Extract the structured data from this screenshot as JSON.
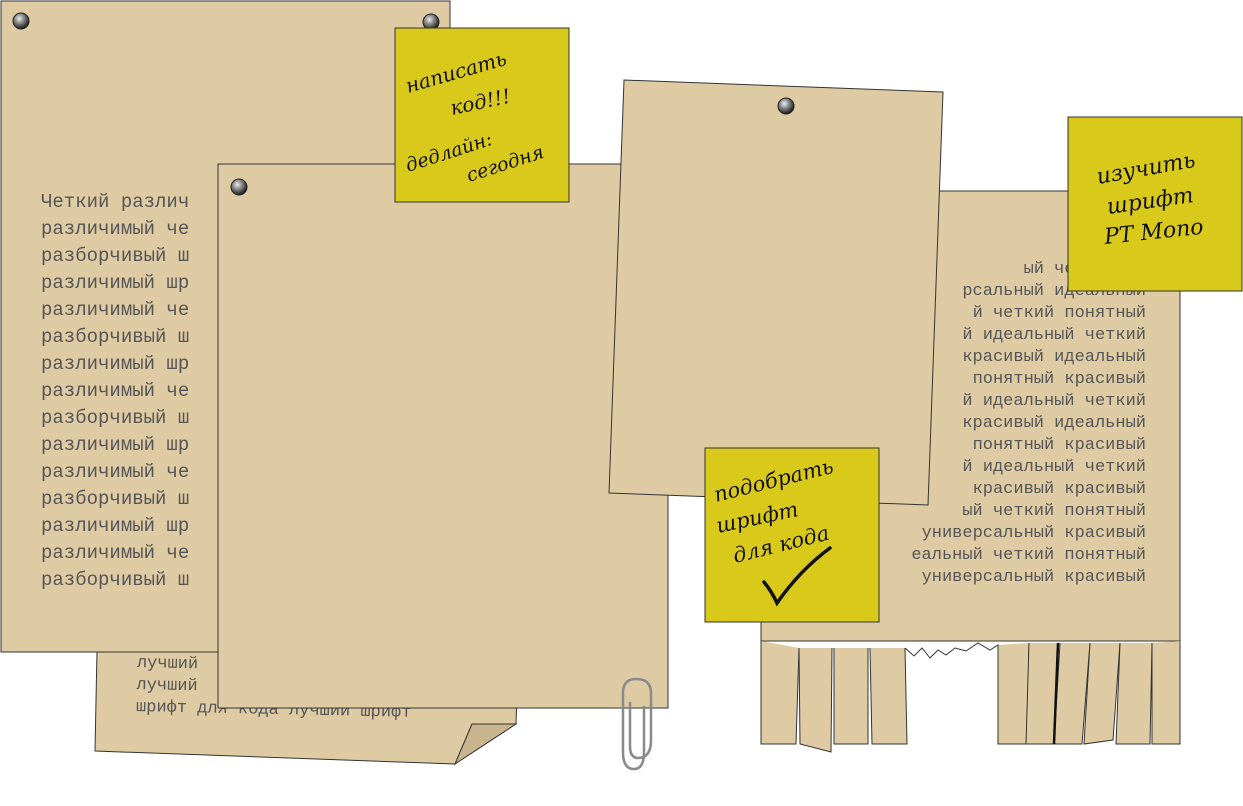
{
  "colors": {
    "paper": "#decba4",
    "sticky": "#d9c91a",
    "ink": "#111111",
    "text": "#555555",
    "outline": "#333333"
  },
  "left_sheet": {
    "lines": [
      "Четкий различ",
      "различимый че",
      "разборчивый ш",
      "различимый шр",
      "различимый че",
      "разборчивый ш",
      "различимый шр",
      "различимый че",
      "разборчивый ш",
      "различимый шр",
      "различимый че",
      "разборчивый ш",
      "различимый шр",
      "различимый че",
      "разборчивый ш"
    ]
  },
  "bottom_sheet": {
    "lines": [
      "лучший",
      "лучший",
      "шрифт для кода лучший шрифт"
    ]
  },
  "right_sheet": {
    "lines": [
      "ый четкий по",
      "рсальный идеальный",
      "й четкий понятный",
      "й идеальный четкий",
      "красивый идеальный",
      "понятный красивый",
      "й идеальный четкий",
      "красивый идеальный",
      "понятный красивый",
      "й идеальный четкий",
      "красивый красивый",
      "ый четкий понятный",
      "универсальный красивый",
      "еальный четкий понятный",
      "универсальный красивый"
    ]
  },
  "sticky_notes": {
    "note1": [
      "написать",
      "код!!!",
      "дедлайн:",
      "сегодня"
    ],
    "note2": [
      "изучить",
      "шрифт",
      "PT Mono"
    ],
    "note3": [
      "подобрать",
      "шрифт",
      "для кода"
    ]
  },
  "icons": [
    "pin-icon",
    "paperclip-icon",
    "checkmark-icon"
  ]
}
